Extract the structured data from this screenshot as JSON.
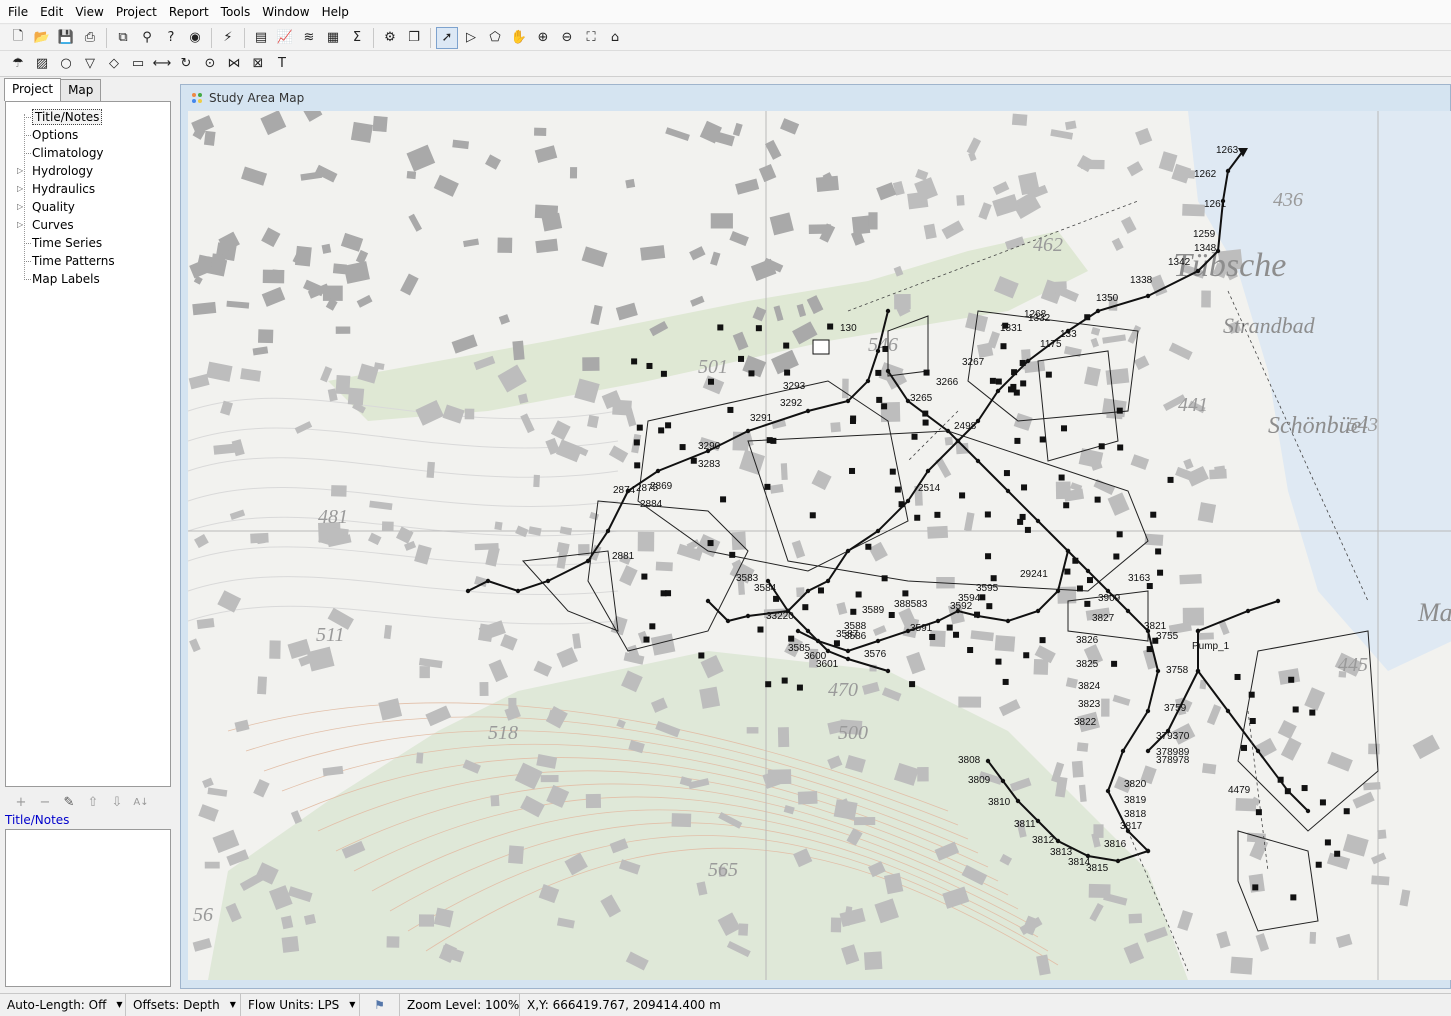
{
  "menu": [
    "File",
    "Edit",
    "View",
    "Project",
    "Report",
    "Tools",
    "Window",
    "Help"
  ],
  "toolbar_main": [
    "new-icon",
    "open-icon",
    "save-icon",
    "print-icon",
    "copy-icon",
    "find-icon",
    "query-icon",
    "overview-map-icon",
    "run-icon",
    "table-icon",
    "graph-icon",
    "contour-icon",
    "statistics-icon",
    "summary-icon",
    "options-icon",
    "arrange-icon",
    "select-icon",
    "select-vertex-icon",
    "select-region-icon",
    "pan-icon",
    "zoom-in-icon",
    "zoom-out-icon",
    "full-extent-icon",
    "add-label-icon"
  ],
  "toolbar_objects": [
    "raingage-icon",
    "subcatchment-icon",
    "junction-icon",
    "outfall-icon",
    "divider-icon",
    "storage-icon",
    "conduit-icon",
    "pump-icon",
    "orifice-icon",
    "weir-icon",
    "outlet-icon",
    "text-label-icon"
  ],
  "left_panel": {
    "tabs": [
      "Project",
      "Map"
    ],
    "active_tab": "Project",
    "tree": [
      {
        "label": "Title/Notes",
        "expandable": false,
        "selected": true
      },
      {
        "label": "Options",
        "expandable": false
      },
      {
        "label": "Climatology",
        "expandable": false
      },
      {
        "label": "Hydrology",
        "expandable": true
      },
      {
        "label": "Hydraulics",
        "expandable": true
      },
      {
        "label": "Quality",
        "expandable": true
      },
      {
        "label": "Curves",
        "expandable": true
      },
      {
        "label": "Time Series",
        "expandable": false
      },
      {
        "label": "Time Patterns",
        "expandable": false
      },
      {
        "label": "Map Labels",
        "expandable": false
      }
    ],
    "description_title": "Title/Notes"
  },
  "map_window": {
    "title": "Study Area Map",
    "elevation_labels": [
      "436",
      "462",
      "501",
      "546",
      "481",
      "511",
      "518",
      "470",
      "500",
      "565",
      "543",
      "445",
      "441",
      "56"
    ],
    "place_names": [
      "Tübsche",
      "Strandbad",
      "Schönbüel",
      "Ma"
    ],
    "node_labels": [
      "1263",
      "1262",
      "1261",
      "1259",
      "1348",
      "1342",
      "1338",
      "1350",
      "1268",
      "1331",
      "1332",
      "1175",
      "133",
      "130",
      "3267",
      "3266",
      "3265",
      "3293",
      "3292",
      "3291",
      "3290",
      "3283",
      "2874",
      "2875",
      "2869",
      "2884",
      "2881",
      "3591",
      "3594",
      "3595",
      "3589",
      "3588",
      "3587",
      "3585",
      "3583",
      "3584",
      "3586",
      "3600",
      "3601",
      "3576",
      "33220",
      "3592",
      "388583",
      "29241",
      "3827",
      "3826",
      "3825",
      "3824",
      "3823",
      "3822",
      "3808",
      "3809",
      "3810",
      "3811",
      "3812",
      "3813",
      "3814",
      "3815",
      "3816",
      "3817",
      "3818",
      "3819",
      "3820",
      "3821",
      "3755",
      "3758",
      "3759",
      "379370",
      "378989",
      "378978",
      "4479",
      "Pump_1",
      "2498",
      "2514",
      "3163",
      "3909"
    ]
  },
  "status_bar": {
    "auto_length": "Auto-Length: Off",
    "offsets": "Offsets: Depth",
    "flow_units": "Flow Units: LPS",
    "zoom_level": "Zoom Level: 100%",
    "coordinates": "X,Y: 666419.767, 209414.400 m"
  }
}
